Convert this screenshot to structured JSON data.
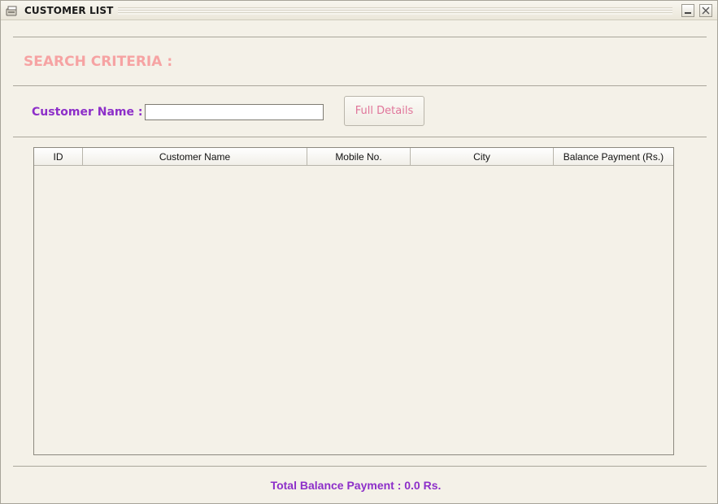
{
  "window": {
    "title": "CUSTOMER LIST",
    "icon": "app-icon",
    "controls": [
      "minimize-icon",
      "close-icon"
    ]
  },
  "search": {
    "section_title": "SEARCH CRITERIA :",
    "customer_name_label": "Customer Name :",
    "customer_name_value": "",
    "full_details_label": "Full Details"
  },
  "table": {
    "columns": [
      "ID",
      "Customer Name",
      "Mobile No.",
      "City",
      "Balance Payment (Rs.)"
    ],
    "rows": []
  },
  "footer": {
    "total_text": "Total Balance Payment : 0.0 Rs."
  },
  "colors": {
    "section_title": "#f6a3a3",
    "label_purple": "#8d2fc9",
    "button_text": "#e0759a",
    "background": "#f4f1e8"
  }
}
